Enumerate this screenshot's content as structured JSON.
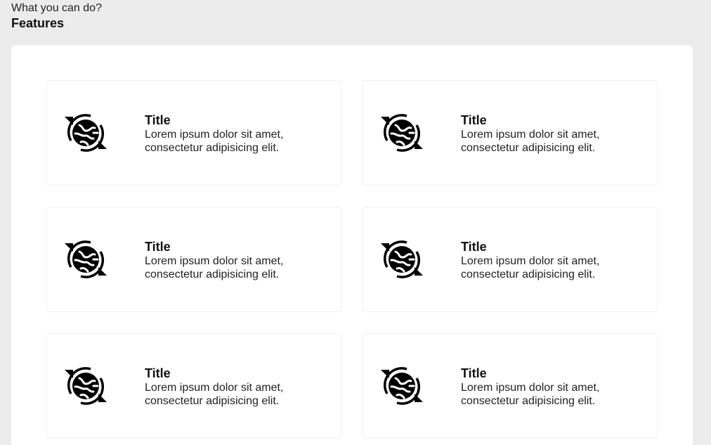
{
  "header": {
    "subtitle": "What you can do?",
    "title": "Features"
  },
  "features": [
    {
      "title": "Title",
      "line1": "Lorem ipsum dolor sit amet,",
      "line2": "consectetur adipisicing elit.",
      "icon": "globe-sync-icon"
    },
    {
      "title": "Title",
      "line1": "Lorem ipsum dolor sit amet,",
      "line2": "consectetur adipisicing elit.",
      "icon": "globe-sync-icon"
    },
    {
      "title": "Title",
      "line1": "Lorem ipsum dolor sit amet,",
      "line2": "consectetur adipisicing elit.",
      "icon": "globe-sync-icon"
    },
    {
      "title": "Title",
      "line1": "Lorem ipsum dolor sit amet,",
      "line2": "consectetur adipisicing elit.",
      "icon": "globe-sync-icon"
    },
    {
      "title": "Title",
      "line1": "Lorem ipsum dolor sit amet,",
      "line2": "consectetur adipisicing elit.",
      "icon": "globe-sync-icon"
    },
    {
      "title": "Title",
      "line1": "Lorem ipsum dolor sit amet,",
      "line2": "consectetur adipisicing elit.",
      "icon": "globe-sync-icon"
    }
  ],
  "colors": {
    "background": "#ececec",
    "panel": "#ffffff",
    "card_border": "#f0f0f0",
    "icon": "#000000"
  }
}
